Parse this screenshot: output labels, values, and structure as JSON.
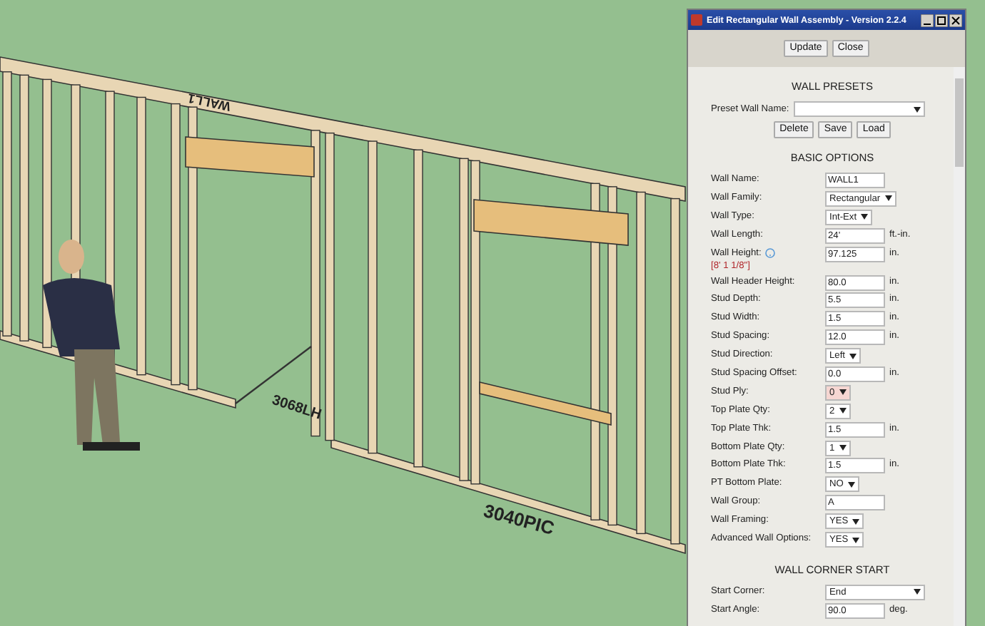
{
  "scene": {
    "labels": [
      {
        "text": "WALL1",
        "kind": "plate"
      },
      {
        "text": "3068LH",
        "kind": "door"
      },
      {
        "text": "3040PIC",
        "kind": "window"
      }
    ]
  },
  "window": {
    "title": "Edit  Rectangular Wall Assembly - Version 2.2.4"
  },
  "top_buttons": [
    "Update",
    "Close"
  ],
  "presets": {
    "heading": "WALL PRESETS",
    "label": "Preset Wall Name:",
    "buttons": [
      "Delete",
      "Save",
      "Load"
    ]
  },
  "sections": [
    {
      "heading": "BASIC OPTIONS",
      "fields": [
        {
          "label": "Wall Name:",
          "kind": "text",
          "value": "WALL1"
        },
        {
          "label": "Wall Family:",
          "kind": "select",
          "value": "Rectangular"
        },
        {
          "label": "Wall Type:",
          "kind": "select",
          "value": "Int-Ext"
        },
        {
          "label": "Wall Length:",
          "kind": "text",
          "value": "24'",
          "unit": "ft.-in."
        },
        {
          "label": "Wall Height:",
          "kind": "text",
          "value": "97.125",
          "unit": "in.",
          "help": true,
          "note": "[8' 1 1/8\"]"
        },
        {
          "label": "Wall Header Height:",
          "kind": "text",
          "value": "80.0",
          "unit": "in."
        },
        {
          "label": "Stud Depth:",
          "kind": "text",
          "value": "5.5",
          "unit": "in."
        },
        {
          "label": "Stud Width:",
          "kind": "text",
          "value": "1.5",
          "unit": "in."
        },
        {
          "label": "Stud Spacing:",
          "kind": "text",
          "value": "12.0",
          "unit": "in."
        },
        {
          "label": "Stud Direction:",
          "kind": "select",
          "value": "Left"
        },
        {
          "label": "Stud Spacing Offset:",
          "kind": "text",
          "value": "0.0",
          "unit": "in."
        },
        {
          "label": "Stud Ply:",
          "kind": "select",
          "value": "0",
          "highlighted": true
        },
        {
          "label": "Top Plate Qty:",
          "kind": "select",
          "value": "2"
        },
        {
          "label": "Top Plate Thk:",
          "kind": "text",
          "value": "1.5",
          "unit": "in."
        },
        {
          "label": "Bottom Plate Qty:",
          "kind": "select",
          "value": "1"
        },
        {
          "label": "Bottom Plate Thk:",
          "kind": "text",
          "value": "1.5",
          "unit": "in."
        },
        {
          "label": "PT Bottom Plate:",
          "kind": "select",
          "value": "NO"
        },
        {
          "label": "Wall Group:",
          "kind": "text",
          "value": "A"
        },
        {
          "label": "Wall Framing:",
          "kind": "select",
          "value": "YES"
        },
        {
          "label": "Advanced Wall Options:",
          "kind": "select",
          "value": "YES"
        }
      ]
    },
    {
      "heading": "WALL CORNER START",
      "fields": [
        {
          "label": "Start Corner:",
          "kind": "wide-select",
          "value": "End"
        },
        {
          "label": "Start Angle:",
          "kind": "text",
          "value": "90.0",
          "unit": "deg."
        }
      ]
    }
  ]
}
